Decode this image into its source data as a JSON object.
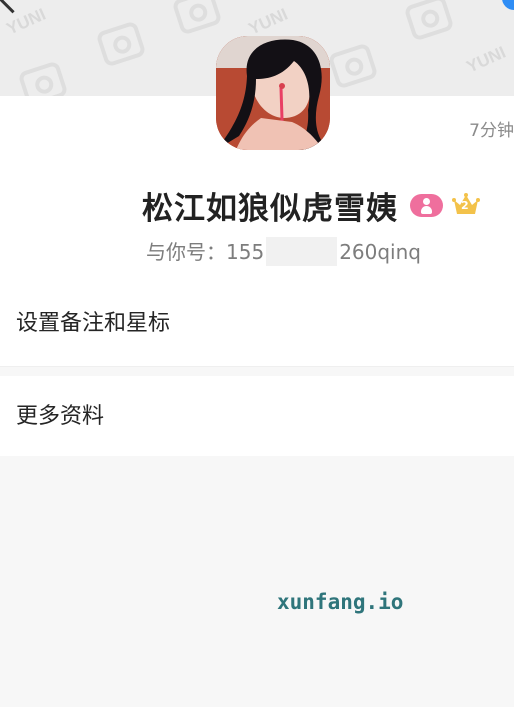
{
  "profile": {
    "last_seen": "7分钟",
    "nickname": "松江如狼似虎雪姨",
    "gender": "female",
    "level_badge": "2",
    "account_prefix": "与你号：155",
    "account_suffix": "260qinq",
    "background_watermark": "YUNI"
  },
  "menu": {
    "remark_star": "设置备注和星标",
    "more_info": "更多资料"
  },
  "watermark": "xunfang.io",
  "colors": {
    "gender_badge": "#ef6f9d",
    "crown": "#f3c24a",
    "watermark": "#2f757b"
  }
}
